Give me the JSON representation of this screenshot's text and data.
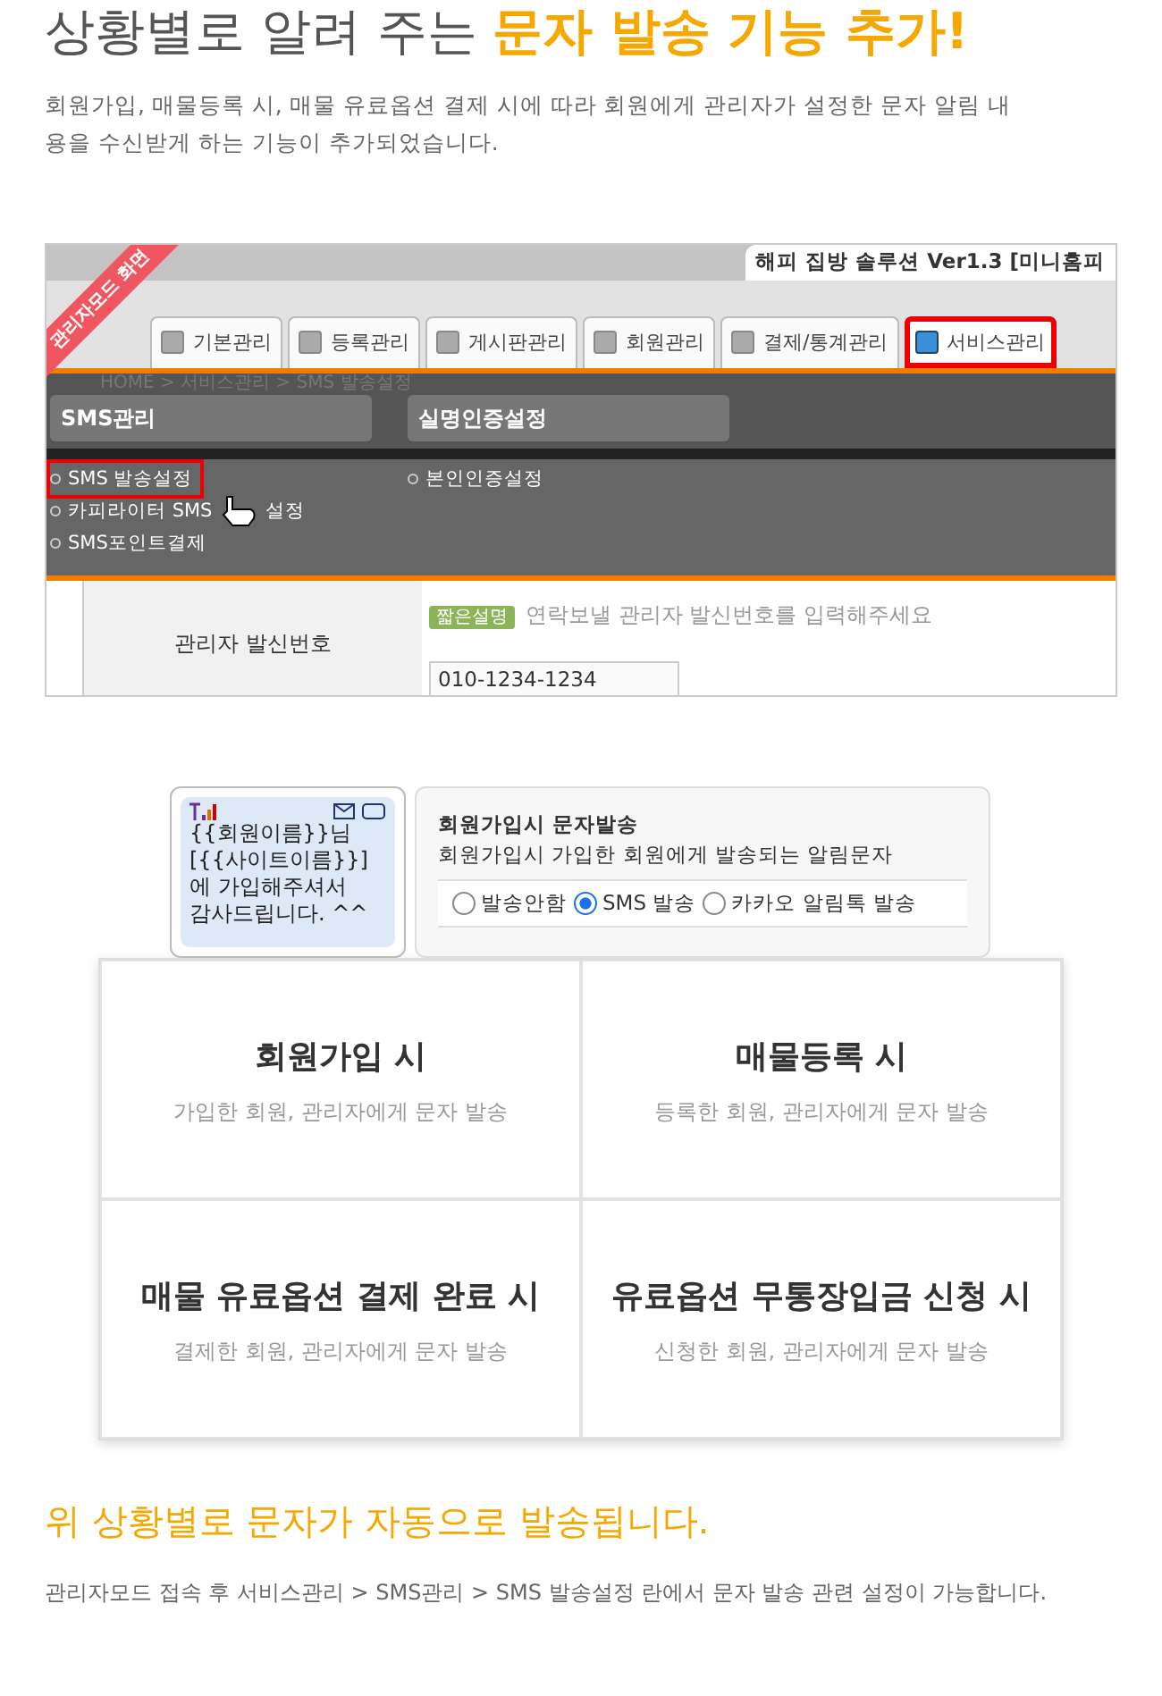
{
  "heading": {
    "lead": "상황별로 알려 주는",
    "highlight": "문자 발송 기능 추가!"
  },
  "intro": "회원가입, 매물등록 시, 매물 유료옵션 결제 시에 따라 회원에게 관리자가 설정한 문자 알림 내용을 수신받게 하는 기능이 추가되었습니다.",
  "admin_screen": {
    "ribbon": "관리자모드 화면",
    "product_title": "해피 집방 솔루션 Ver1.3 [미니홈피",
    "tabs": [
      {
        "label": "기본관리",
        "selected": false
      },
      {
        "label": "등록관리",
        "selected": false
      },
      {
        "label": "게시판관리",
        "selected": false
      },
      {
        "label": "회원관리",
        "selected": false
      },
      {
        "label": "결제/통계관리",
        "selected": false
      },
      {
        "label": "서비스관리",
        "selected": true
      }
    ],
    "breadcrumb": "HOME > 서비스관리 > SMS 발송설정",
    "menus": [
      {
        "title": "SMS관리",
        "items": [
          {
            "label": "SMS 발송설정",
            "highlighted": true
          },
          {
            "label": "카피라이터 SMS",
            "tail": "설정",
            "highlighted": false
          },
          {
            "label": "SMS포인트결제",
            "highlighted": false
          }
        ]
      },
      {
        "title": "실명인증설정",
        "items": [
          {
            "label": "본인인증설정",
            "highlighted": false
          }
        ]
      }
    ],
    "form": {
      "label": "관리자 발신번호",
      "badge": "짧은설명",
      "hint": "연락보낼 관리자 발신번호를 입력해주세요",
      "value": "010-1234-1234"
    }
  },
  "sms_preview": {
    "message_lines": [
      "{{회원이름}}님",
      "[{{사이트이름}}]",
      "에 가입해주셔서",
      "감사드립니다. ^^"
    ]
  },
  "sms_setting": {
    "title": "회원가입시 문자발송",
    "description": "회원가입시 가입한 회원에게 발송되는 알림문자",
    "options": [
      {
        "label": "발송안함",
        "selected": false
      },
      {
        "label": "SMS 발송",
        "selected": true
      },
      {
        "label": "카카오 알림톡 발송",
        "selected": false
      }
    ]
  },
  "situations": [
    {
      "title": "회원가입 시",
      "subtitle": "가입한 회원, 관리자에게 문자 발송"
    },
    {
      "title": "매물등록 시",
      "subtitle": "등록한 회원, 관리자에게 문자 발송"
    },
    {
      "title": "매물 유료옵션 결제 완료 시",
      "subtitle": "결제한 회원, 관리자에게 문자 발송"
    },
    {
      "title": "유료옵션 무통장입금 신청 시",
      "subtitle": "신청한 회원, 관리자에게 문자 발송"
    }
  ],
  "summary": "위 상황별로 문자가 자동으로 발송됩니다.",
  "footnote": "관리자모드 접속 후 서비스관리 > SMS관리 > SMS 발송설정 란에서 문자 발송 관련 설정이 가능합니다."
}
